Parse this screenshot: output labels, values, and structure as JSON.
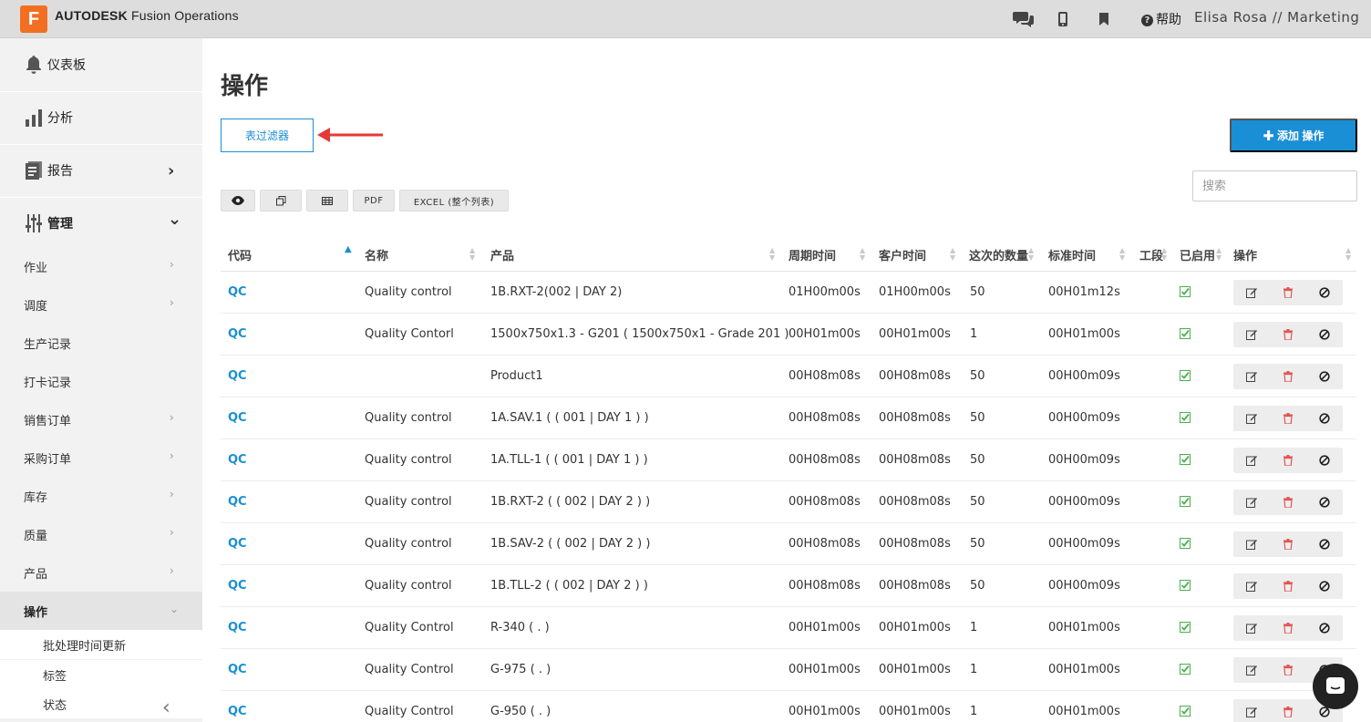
{
  "header": {
    "logo_letter": "F",
    "brand": "AUTODESK",
    "product": "Fusion Operations",
    "help_label": "帮助",
    "user": "Elisa Rosa // Marketing"
  },
  "sidebar": {
    "main": [
      {
        "label": "仪表板",
        "icon": "bell-icon"
      },
      {
        "label": "分析",
        "icon": "bar-chart-icon"
      },
      {
        "label": "报告",
        "icon": "report-icon",
        "chevron": "›"
      },
      {
        "label": "管理",
        "icon": "sliders-icon",
        "chevron": "⌄"
      }
    ],
    "sub": [
      {
        "label": "作业"
      },
      {
        "label": "调度"
      },
      {
        "label": "生产记录"
      },
      {
        "label": "打卡记录"
      },
      {
        "label": "销售订单"
      },
      {
        "label": "采购订单"
      },
      {
        "label": "库存"
      },
      {
        "label": "质量"
      },
      {
        "label": "产品"
      },
      {
        "label": "操作"
      }
    ],
    "sub2": [
      {
        "label": "批处理时间更新"
      },
      {
        "label": "标签"
      },
      {
        "label": "状态"
      }
    ]
  },
  "main": {
    "title": "操作",
    "filter_button": "表过滤器",
    "add_button": "✚ 添加 操作",
    "search_placeholder": "搜索",
    "tools": [
      "👁",
      "⧉",
      "▦",
      "PDF",
      "EXCEL (整个列表)"
    ]
  },
  "table": {
    "columns": [
      "代码",
      "名称",
      "产品",
      "周期时间",
      "客户时间",
      "这次的数量",
      "标准时间",
      "工段",
      "已启用",
      "操作"
    ],
    "rows": [
      {
        "code": "QC",
        "name": "Quality control",
        "product": "1B.RXT-2(002 | DAY 2)",
        "cycle": "01H00m00s",
        "customer": "01H00m00s",
        "qty": "50",
        "standard": "00H01m12s"
      },
      {
        "code": "QC",
        "name": "Quality Contorl",
        "product": "1500x750x1.3 - G201 ( 1500x750x1 - Grade 201 )",
        "cycle": "00H01m00s",
        "customer": "00H01m00s",
        "qty": "1",
        "standard": "00H01m00s"
      },
      {
        "code": "QC",
        "name": "",
        "product": "Product1",
        "cycle": "00H08m08s",
        "customer": "00H08m08s",
        "qty": "50",
        "standard": "00H00m09s"
      },
      {
        "code": "QC",
        "name": "Quality control",
        "product": "1A.SAV.1 ( ( 001 | DAY 1 ) )",
        "cycle": "00H08m08s",
        "customer": "00H08m08s",
        "qty": "50",
        "standard": "00H00m09s"
      },
      {
        "code": "QC",
        "name": "Quality control",
        "product": "1A.TLL-1 ( ( 001 | DAY 1 ) )",
        "cycle": "00H08m08s",
        "customer": "00H08m08s",
        "qty": "50",
        "standard": "00H00m09s"
      },
      {
        "code": "QC",
        "name": "Quality control",
        "product": "1B.RXT-2 ( ( 002 | DAY 2 ) )",
        "cycle": "00H08m08s",
        "customer": "00H08m08s",
        "qty": "50",
        "standard": "00H00m09s"
      },
      {
        "code": "QC",
        "name": "Quality control",
        "product": "1B.SAV-2 ( ( 002 | DAY 2 ) )",
        "cycle": "00H08m08s",
        "customer": "00H08m08s",
        "qty": "50",
        "standard": "00H00m09s"
      },
      {
        "code": "QC",
        "name": "Quality control",
        "product": "1B.TLL-2 ( ( 002 | DAY 2 ) )",
        "cycle": "00H08m08s",
        "customer": "00H08m08s",
        "qty": "50",
        "standard": "00H00m09s"
      },
      {
        "code": "QC",
        "name": "Quality Control",
        "product": "R-340 ( . )",
        "cycle": "00H01m00s",
        "customer": "00H01m00s",
        "qty": "1",
        "standard": "00H01m00s"
      },
      {
        "code": "QC",
        "name": "Quality Control",
        "product": "G-975 ( . )",
        "cycle": "00H01m00s",
        "customer": "00H01m00s",
        "qty": "1",
        "standard": "00H01m00s"
      },
      {
        "code": "QC",
        "name": "Quality Control",
        "product": "G-950 ( . )",
        "cycle": "00H01m00s",
        "customer": "00H01m00s",
        "qty": "1",
        "standard": "00H01m00s"
      }
    ]
  },
  "colors": {
    "accent": "#1a8fd6",
    "check": "#4caf50",
    "delete": "#e05555",
    "arrow": "#e53935"
  }
}
